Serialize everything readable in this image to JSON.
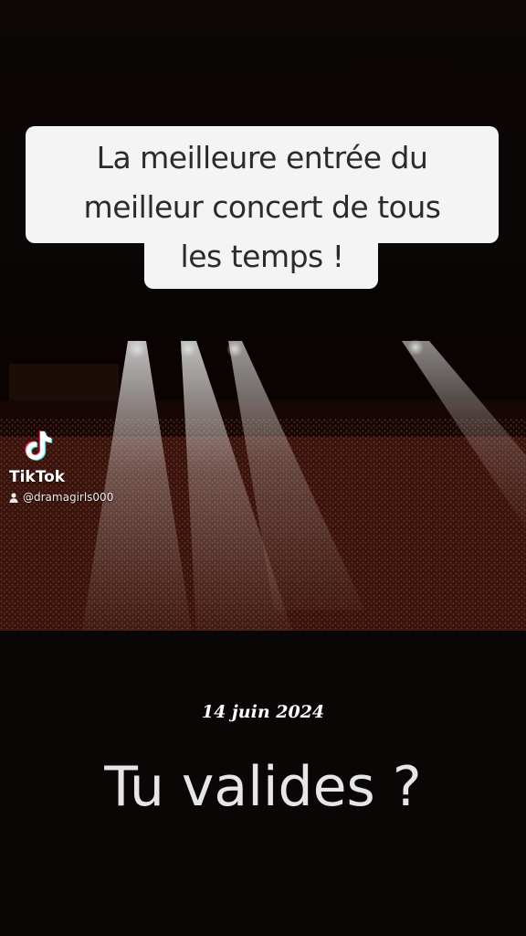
{
  "caption": {
    "lines": [
      "La meilleure entrée du",
      "meilleur concert de tous",
      "les temps !"
    ]
  },
  "watermark": {
    "brand": "TikTok",
    "username": "@dramagirls000",
    "icon": "tiktok-note-icon"
  },
  "overlay": {
    "date": "14 juin 2024",
    "question": "Tu valides ?"
  },
  "colors": {
    "caption_bg": "#f4f4f4",
    "caption_text": "#2b2b2b",
    "crowd": "#6a2a1a",
    "background": "#0a0505"
  }
}
